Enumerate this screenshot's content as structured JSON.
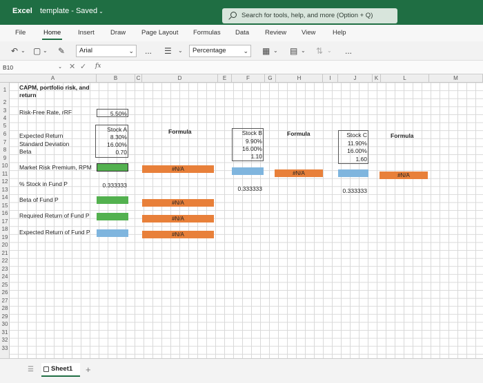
{
  "titlebar": {
    "app_name": "Excel",
    "doc_title": "template - Saved",
    "search_placeholder": "Search for tools, help, and more (Option + Q)"
  },
  "ribbon": {
    "tabs": [
      "File",
      "Home",
      "Insert",
      "Draw",
      "Page Layout",
      "Formulas",
      "Data",
      "Review",
      "View",
      "Help"
    ],
    "active_tab": "Home"
  },
  "toolbar": {
    "font": "Arial",
    "number_format": "Percentage",
    "more": "..."
  },
  "formula_bar": {
    "name_box": "B10",
    "fx": "fx"
  },
  "columns": [
    "A",
    "B",
    "C",
    "D",
    "E",
    "F",
    "G",
    "H",
    "I",
    "J",
    "K",
    "L",
    "M"
  ],
  "rows": [
    "1",
    "2",
    "3",
    "4",
    "5",
    "6",
    "7",
    "8",
    "9",
    "10",
    "11",
    "12",
    "13",
    "14",
    "15",
    "16",
    "17",
    "18",
    "19",
    "20",
    "21",
    "22",
    "23",
    "24",
    "25",
    "26",
    "27",
    "28",
    "29",
    "30",
    "31",
    "32",
    "33"
  ],
  "cells": {
    "a1_title_line1": "CAPM, portfolio risk, and",
    "a1_title_line2": "return",
    "a3_label": "Risk-Free Rate, rRF",
    "b3_value": "5.50%",
    "a6_label": "Expected Return",
    "a7_label": "Standard Deviation",
    "a8_label": "Beta",
    "b5_header": "Stock A",
    "b6_value": "8.30%",
    "b7_value": "16.00%",
    "b8_value": "0.70",
    "d_formula_header": "Formula",
    "f5_header": "Stock B",
    "f6_value": "9.90%",
    "f7_value": "16.00%",
    "f8_value": "1.10",
    "h_formula_header": "Formula",
    "j5_header": "Stock C",
    "j6_value": "11.90%",
    "j7_value": "16.00%",
    "j8_value": "1.60",
    "l_formula_header": "Formula",
    "a10_label": "Market Risk Premium, RPM",
    "d10_value": "#N/A",
    "h10_value": "#N/A",
    "l10_value": "#N/A",
    "a12_label": "% Stock in Fund P",
    "b12_value": "0.333333",
    "f12_value": "0.333333",
    "j12_value": "0.333333",
    "a14_label": "Beta of Fund P",
    "d14_value": "#N/A",
    "a16_label": "Required Return of Fund P",
    "d16_value": "#N/A",
    "a18_label": "Expected Return of Fund P",
    "d18_value": "#N/A"
  },
  "sheets": {
    "active": "Sheet1",
    "add": "+"
  },
  "colors": {
    "brand": "#1f6e43",
    "input_green": "#53b14f",
    "output_blue": "#7fb5de",
    "formula_orange": "#e8803a"
  }
}
